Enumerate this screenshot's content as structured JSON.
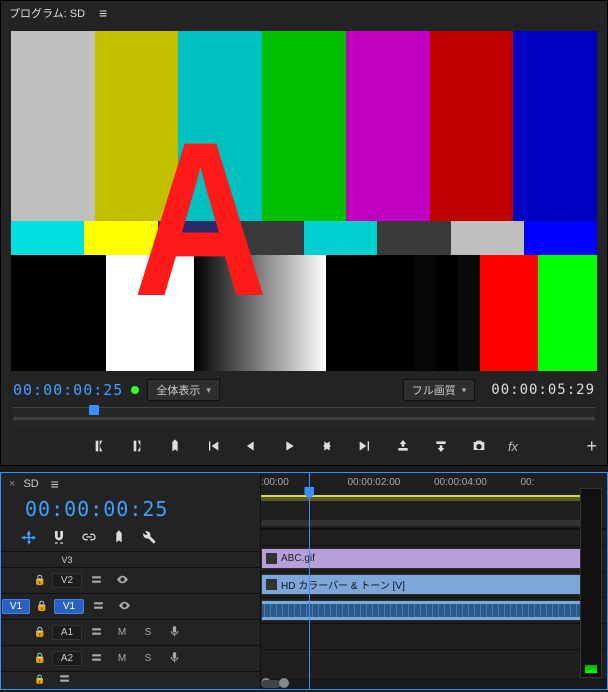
{
  "program": {
    "title": "プログラム: SD",
    "currentTimecode": "00:00:00:25",
    "duration": "00:00:05:29",
    "zoomDropdownLabel": "全体表示",
    "qualityDropdownLabel": "フル画質",
    "overlayLetter": "A"
  },
  "transport": {
    "fxLabel": "fx"
  },
  "timeline": {
    "sequenceName": "SD",
    "currentTimecode": "00:00:00:25",
    "rulerLabels": [
      ":00:00",
      "00:00:02:00",
      "00:00:04:00",
      "00:"
    ],
    "tracks": {
      "v3": "V3",
      "v2": "V2",
      "v1patch": "V1",
      "v1": "V1",
      "a1": "A1",
      "a2": "A2",
      "m": "M",
      "s": "S"
    },
    "clips": {
      "v2": "ABC.gif",
      "v1": "HD カラーバー & トーン [V]"
    }
  }
}
